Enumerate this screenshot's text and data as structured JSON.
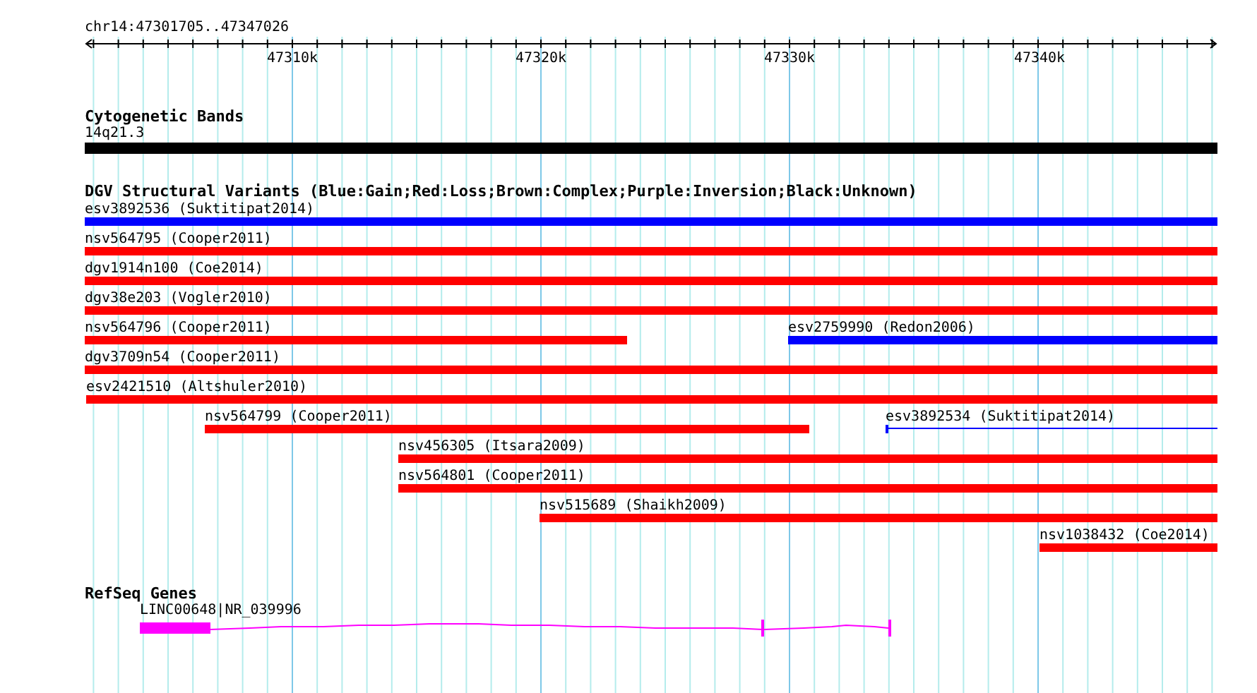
{
  "ruler": {
    "location": "chr14:47301705..47347026",
    "tick_labels": [
      "47310k",
      "47320k",
      "47330k",
      "47340k"
    ]
  },
  "cytogenetic_bands": {
    "title": "Cytogenetic Bands",
    "band_label": "14q21.3"
  },
  "variants": {
    "title": "DGV Structural Variants (Blue:Gain;Red:Loss;Brown:Complex;Purple:Inversion;Black:Unknown)",
    "rows": [
      {
        "features": [
          {
            "label": "esv3892536 (Suktitipat2014)",
            "color": "#0000ff",
            "kind": "bar"
          }
        ]
      },
      {
        "features": [
          {
            "label": "nsv564795 (Cooper2011)",
            "color": "#ff0000",
            "kind": "bar"
          }
        ]
      },
      {
        "features": [
          {
            "label": "dgv1914n100 (Coe2014)",
            "color": "#ff0000",
            "kind": "bar"
          }
        ]
      },
      {
        "features": [
          {
            "label": "dgv38e203 (Vogler2010)",
            "color": "#ff0000",
            "kind": "bar"
          }
        ]
      },
      {
        "features": [
          {
            "label": "nsv564796 (Cooper2011)",
            "color": "#ff0000",
            "kind": "bar"
          },
          {
            "label": "esv2759990 (Redon2006)",
            "color": "#0000ff",
            "kind": "bar"
          }
        ]
      },
      {
        "features": [
          {
            "label": "dgv3709n54 (Cooper2011)",
            "color": "#ff0000",
            "kind": "bar"
          }
        ]
      },
      {
        "features": [
          {
            "label": "esv2421510 (Altshuler2010)",
            "color": "#ff0000",
            "kind": "bar"
          }
        ]
      },
      {
        "features": [
          {
            "label": "nsv564799 (Cooper2011)",
            "color": "#ff0000",
            "kind": "bar"
          },
          {
            "label": "esv3892534 (Suktitipat2014)",
            "color": "#0000ff",
            "kind": "line"
          }
        ]
      },
      {
        "features": [
          {
            "label": "nsv456305 (Itsara2009)",
            "color": "#ff0000",
            "kind": "bar"
          }
        ]
      },
      {
        "features": [
          {
            "label": "nsv564801 (Cooper2011)",
            "color": "#ff0000",
            "kind": "bar"
          }
        ]
      },
      {
        "features": [
          {
            "label": "nsv515689 (Shaikh2009)",
            "color": "#ff0000",
            "kind": "bar"
          }
        ]
      },
      {
        "features": [
          {
            "label": "nsv1038432 (Coe2014)",
            "color": "#ff0000",
            "kind": "bar"
          }
        ]
      }
    ]
  },
  "refseq_genes": {
    "title": "RefSeq Genes",
    "genes": [
      {
        "label": "LINC00648|NR_039996",
        "color": "#ff00ff"
      }
    ]
  }
}
